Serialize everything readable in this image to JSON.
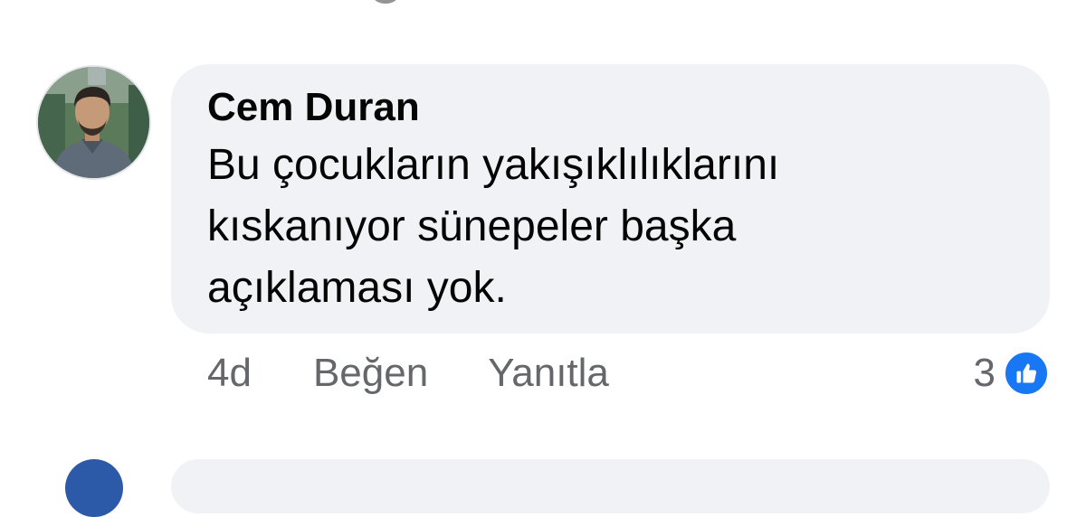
{
  "comment": {
    "author": "Cem Duran",
    "text": "Bu çocukların yakışıklılıklarını kıskanıyor sünepeler başka açıklaması yok.",
    "time": "4d",
    "like_label": "Beğen",
    "reply_label": "Yanıtla",
    "reaction_count": "3",
    "reaction_icon": "thumbs-up-icon",
    "avatar_icon": "user-avatar"
  },
  "colors": {
    "bubble_background": "#f0f2f5",
    "secondary_text": "#65676b",
    "like_blue": "#1877f2"
  }
}
